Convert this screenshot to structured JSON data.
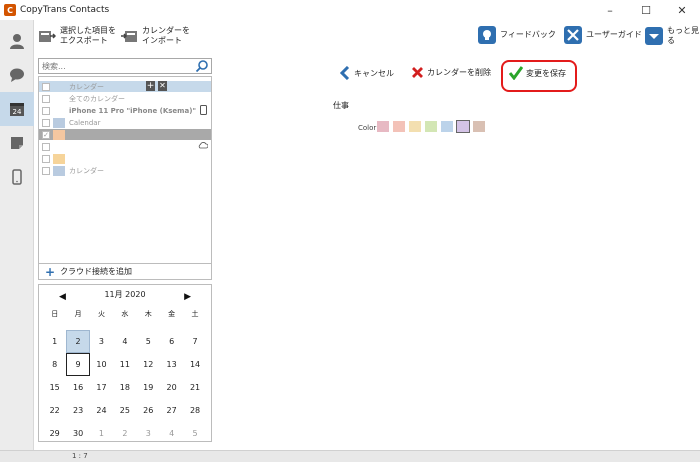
{
  "window": {
    "title": "CopyTrans Contacts",
    "minimize": "–",
    "maximize": "☐",
    "close": "✕"
  },
  "toolbar": {
    "export_label": "選択した項目を\nエクスポート",
    "import_label": "カレンダーを\nインポート",
    "feedback_label": "フィードバック",
    "guide_label": "ユーザーガイド",
    "more_label": "もっと見る"
  },
  "search": {
    "placeholder": "検索..."
  },
  "calendars": {
    "rows": [
      {
        "label": "カレンダー",
        "color": ""
      },
      {
        "label": "全てのカレンダー",
        "color": ""
      },
      {
        "label": "iPhone 11 Pro \"iPhone (Ksema)\"",
        "color": ""
      },
      {
        "label": "Calendar",
        "color": "#b9cbe0"
      },
      {
        "label": "",
        "color": "#f5c7a0"
      },
      {
        "label": "",
        "color": ""
      },
      {
        "label": "",
        "color": "#f6d49a"
      },
      {
        "label": "カレンダー",
        "color": "#b9cbe0"
      }
    ],
    "add_cloud": "クラウド接続を追加"
  },
  "mini_calendar": {
    "month_label": "11月 2020",
    "prev": "◀",
    "next": "▶",
    "dow": [
      "日",
      "月",
      "火",
      "水",
      "木",
      "金",
      "土"
    ],
    "days": [
      [
        "1",
        "2",
        "3",
        "4",
        "5",
        "6",
        "7"
      ],
      [
        "8",
        "9",
        "10",
        "11",
        "12",
        "13",
        "14"
      ],
      [
        "15",
        "16",
        "17",
        "18",
        "19",
        "20",
        "21"
      ],
      [
        "22",
        "23",
        "24",
        "25",
        "26",
        "27",
        "28"
      ],
      [
        "29",
        "30",
        "1",
        "2",
        "3",
        "4",
        "5"
      ]
    ],
    "selected": "2",
    "today": "9"
  },
  "actions": {
    "cancel": "キャンセル",
    "delete": "カレンダーを削除",
    "save": "変更を保存"
  },
  "editor": {
    "name_value": "仕事",
    "color_label": "Color",
    "colors": [
      "#e7b9c3",
      "#f3c2b8",
      "#f3dfb0",
      "#d3e6b4",
      "#bcd3ea",
      "#d4c3e6",
      "#d9c0b3"
    ]
  },
  "status": {
    "text": "1 : 7"
  },
  "colors": {
    "accent": "#2f6fb0",
    "highlight": "#e31b1b",
    "save_check": "#2aa52a",
    "delete_x": "#d21f1f"
  },
  "icons": {
    "nav": [
      "person-icon",
      "chat-bubble-icon",
      "calendar-icon",
      "note-icon",
      "phone-icon"
    ]
  }
}
